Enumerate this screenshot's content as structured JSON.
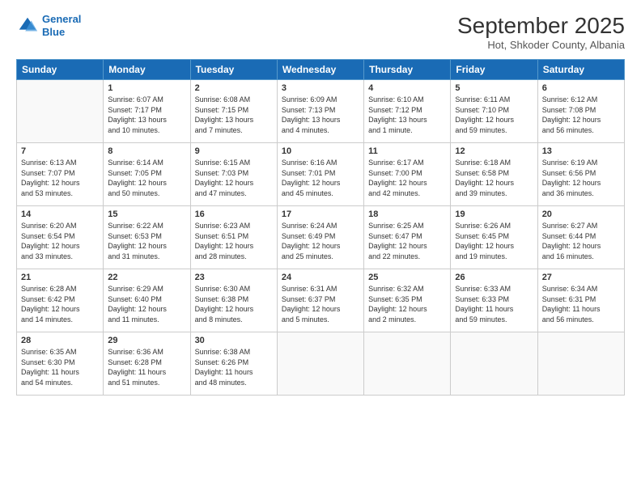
{
  "header": {
    "logo_line1": "General",
    "logo_line2": "Blue",
    "title": "September 2025",
    "location": "Hot, Shkoder County, Albania"
  },
  "days_of_week": [
    "Sunday",
    "Monday",
    "Tuesday",
    "Wednesday",
    "Thursday",
    "Friday",
    "Saturday"
  ],
  "weeks": [
    [
      {
        "day": "",
        "info": ""
      },
      {
        "day": "1",
        "info": "Sunrise: 6:07 AM\nSunset: 7:17 PM\nDaylight: 13 hours\nand 10 minutes."
      },
      {
        "day": "2",
        "info": "Sunrise: 6:08 AM\nSunset: 7:15 PM\nDaylight: 13 hours\nand 7 minutes."
      },
      {
        "day": "3",
        "info": "Sunrise: 6:09 AM\nSunset: 7:13 PM\nDaylight: 13 hours\nand 4 minutes."
      },
      {
        "day": "4",
        "info": "Sunrise: 6:10 AM\nSunset: 7:12 PM\nDaylight: 13 hours\nand 1 minute."
      },
      {
        "day": "5",
        "info": "Sunrise: 6:11 AM\nSunset: 7:10 PM\nDaylight: 12 hours\nand 59 minutes."
      },
      {
        "day": "6",
        "info": "Sunrise: 6:12 AM\nSunset: 7:08 PM\nDaylight: 12 hours\nand 56 minutes."
      }
    ],
    [
      {
        "day": "7",
        "info": "Sunrise: 6:13 AM\nSunset: 7:07 PM\nDaylight: 12 hours\nand 53 minutes."
      },
      {
        "day": "8",
        "info": "Sunrise: 6:14 AM\nSunset: 7:05 PM\nDaylight: 12 hours\nand 50 minutes."
      },
      {
        "day": "9",
        "info": "Sunrise: 6:15 AM\nSunset: 7:03 PM\nDaylight: 12 hours\nand 47 minutes."
      },
      {
        "day": "10",
        "info": "Sunrise: 6:16 AM\nSunset: 7:01 PM\nDaylight: 12 hours\nand 45 minutes."
      },
      {
        "day": "11",
        "info": "Sunrise: 6:17 AM\nSunset: 7:00 PM\nDaylight: 12 hours\nand 42 minutes."
      },
      {
        "day": "12",
        "info": "Sunrise: 6:18 AM\nSunset: 6:58 PM\nDaylight: 12 hours\nand 39 minutes."
      },
      {
        "day": "13",
        "info": "Sunrise: 6:19 AM\nSunset: 6:56 PM\nDaylight: 12 hours\nand 36 minutes."
      }
    ],
    [
      {
        "day": "14",
        "info": "Sunrise: 6:20 AM\nSunset: 6:54 PM\nDaylight: 12 hours\nand 33 minutes."
      },
      {
        "day": "15",
        "info": "Sunrise: 6:22 AM\nSunset: 6:53 PM\nDaylight: 12 hours\nand 31 minutes."
      },
      {
        "day": "16",
        "info": "Sunrise: 6:23 AM\nSunset: 6:51 PM\nDaylight: 12 hours\nand 28 minutes."
      },
      {
        "day": "17",
        "info": "Sunrise: 6:24 AM\nSunset: 6:49 PM\nDaylight: 12 hours\nand 25 minutes."
      },
      {
        "day": "18",
        "info": "Sunrise: 6:25 AM\nSunset: 6:47 PM\nDaylight: 12 hours\nand 22 minutes."
      },
      {
        "day": "19",
        "info": "Sunrise: 6:26 AM\nSunset: 6:45 PM\nDaylight: 12 hours\nand 19 minutes."
      },
      {
        "day": "20",
        "info": "Sunrise: 6:27 AM\nSunset: 6:44 PM\nDaylight: 12 hours\nand 16 minutes."
      }
    ],
    [
      {
        "day": "21",
        "info": "Sunrise: 6:28 AM\nSunset: 6:42 PM\nDaylight: 12 hours\nand 14 minutes."
      },
      {
        "day": "22",
        "info": "Sunrise: 6:29 AM\nSunset: 6:40 PM\nDaylight: 12 hours\nand 11 minutes."
      },
      {
        "day": "23",
        "info": "Sunrise: 6:30 AM\nSunset: 6:38 PM\nDaylight: 12 hours\nand 8 minutes."
      },
      {
        "day": "24",
        "info": "Sunrise: 6:31 AM\nSunset: 6:37 PM\nDaylight: 12 hours\nand 5 minutes."
      },
      {
        "day": "25",
        "info": "Sunrise: 6:32 AM\nSunset: 6:35 PM\nDaylight: 12 hours\nand 2 minutes."
      },
      {
        "day": "26",
        "info": "Sunrise: 6:33 AM\nSunset: 6:33 PM\nDaylight: 11 hours\nand 59 minutes."
      },
      {
        "day": "27",
        "info": "Sunrise: 6:34 AM\nSunset: 6:31 PM\nDaylight: 11 hours\nand 56 minutes."
      }
    ],
    [
      {
        "day": "28",
        "info": "Sunrise: 6:35 AM\nSunset: 6:30 PM\nDaylight: 11 hours\nand 54 minutes."
      },
      {
        "day": "29",
        "info": "Sunrise: 6:36 AM\nSunset: 6:28 PM\nDaylight: 11 hours\nand 51 minutes."
      },
      {
        "day": "30",
        "info": "Sunrise: 6:38 AM\nSunset: 6:26 PM\nDaylight: 11 hours\nand 48 minutes."
      },
      {
        "day": "",
        "info": ""
      },
      {
        "day": "",
        "info": ""
      },
      {
        "day": "",
        "info": ""
      },
      {
        "day": "",
        "info": ""
      }
    ]
  ]
}
